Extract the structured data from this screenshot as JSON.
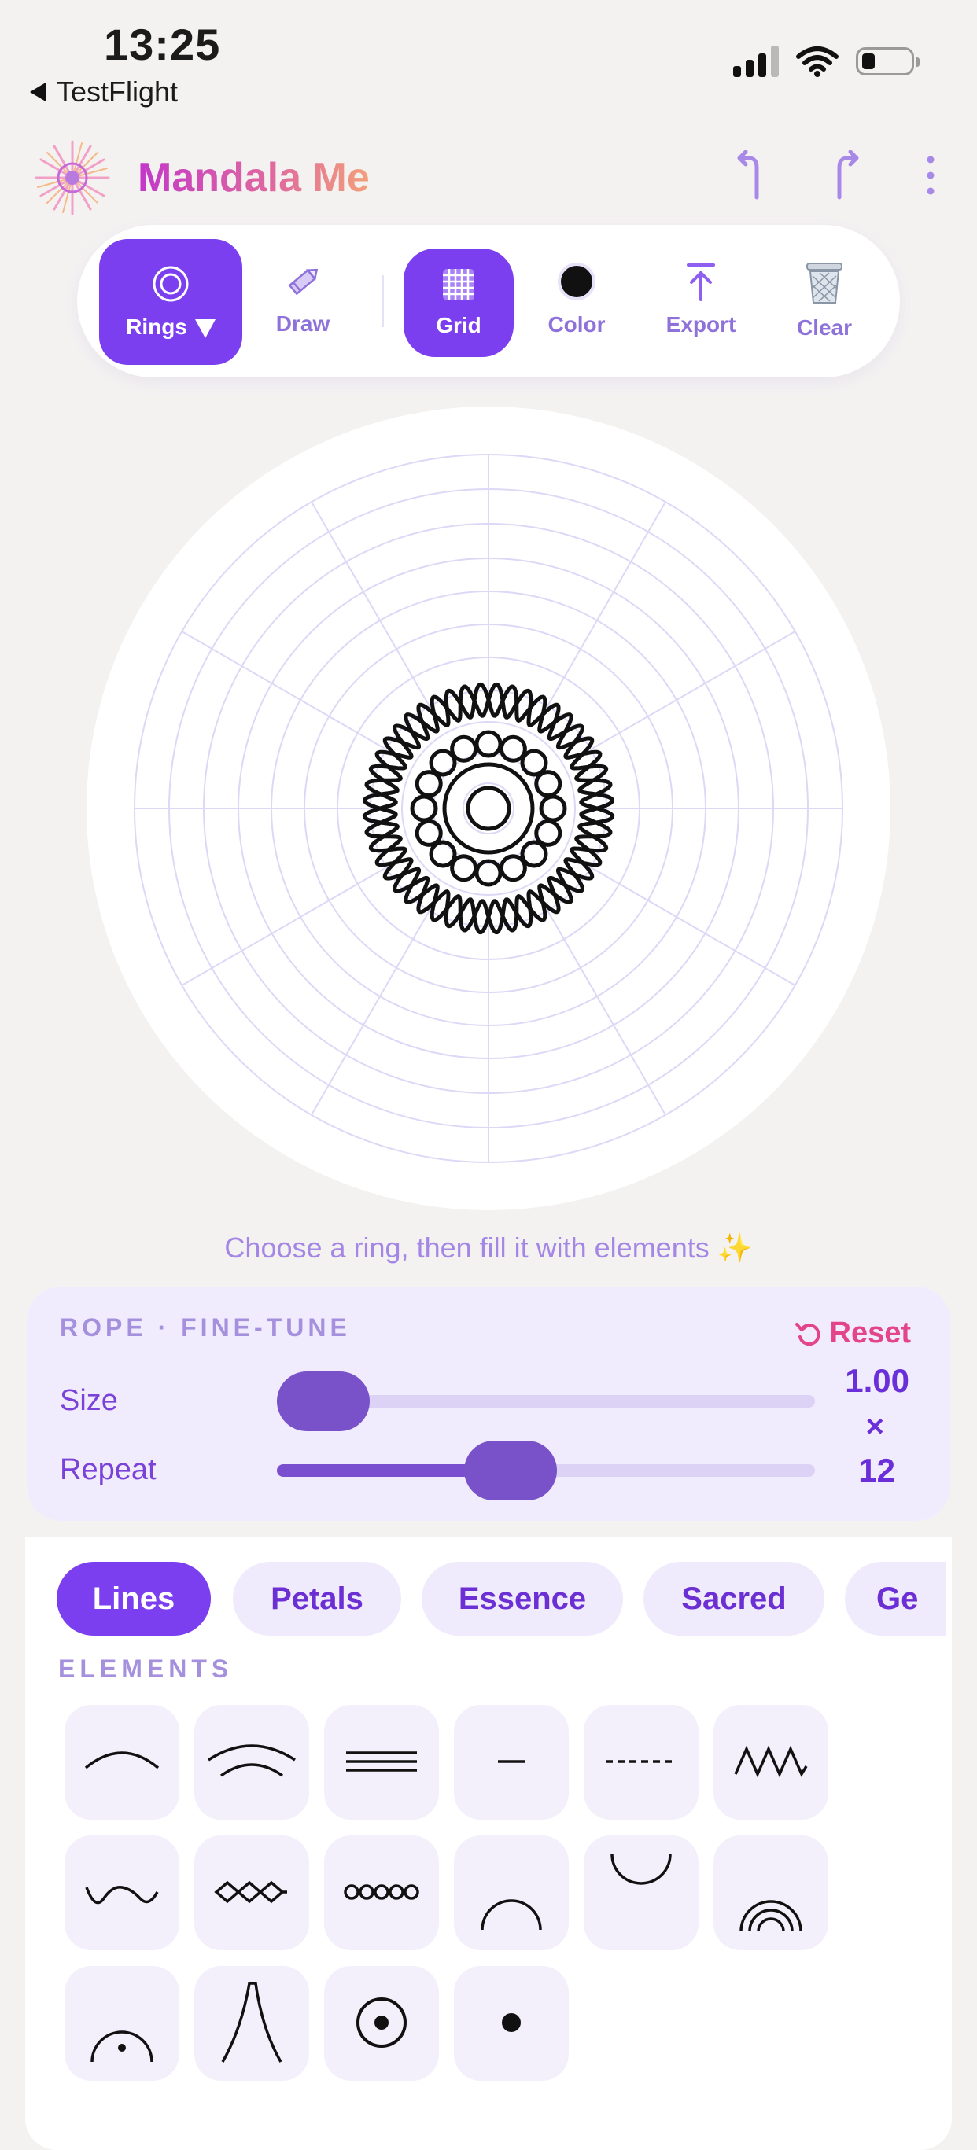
{
  "status_bar": {
    "time": "13:25",
    "back_label": "TestFlight"
  },
  "header": {
    "title": "Mandala Me"
  },
  "toolbar": {
    "rings": "Rings",
    "draw": "Draw",
    "grid": "Grid",
    "color": "Color",
    "export": "Export",
    "clear": "Clear"
  },
  "hint": "Choose a ring, then fill it with elements ✨",
  "fine_tune": {
    "title": "ROPE · FINE-TUNE",
    "reset": "Reset",
    "size_label": "Size",
    "size_value": "1.00",
    "size_unit": "×",
    "size_fraction": 0.0,
    "repeat_label": "Repeat",
    "repeat_value": "12",
    "repeat_fraction": 0.42
  },
  "categories": [
    "Lines",
    "Petals",
    "Essence",
    "Sacred",
    "Ge"
  ],
  "elements_title": "ELEMENTS",
  "elements": [
    "arc",
    "double-arc",
    "triple-line",
    "short-dash",
    "dashed-line",
    "zigzag",
    "wave",
    "diamond-chain",
    "bead-chain",
    "dome",
    "cup",
    "rainbow",
    "dot-dome",
    "spike",
    "dot-in-circle",
    "dot"
  ],
  "colors": {
    "accent": "#7b3ff0",
    "reset": "#e2458a",
    "selected_color": "#111111"
  }
}
